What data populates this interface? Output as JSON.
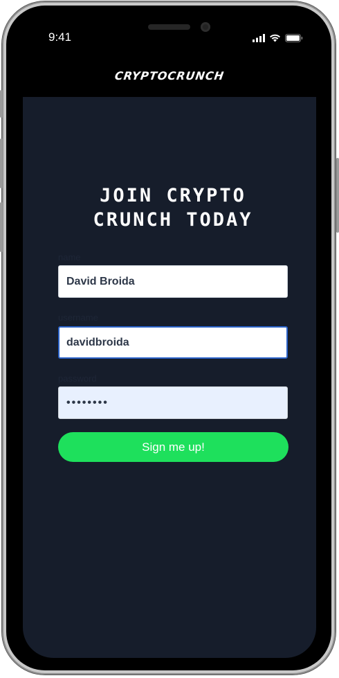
{
  "status_bar": {
    "time": "9:41",
    "icons": [
      "cellular-signal-icon",
      "wifi-icon",
      "battery-icon"
    ]
  },
  "header": {
    "brand": "CRYPTOCRUNCH"
  },
  "main": {
    "headline_line1": "JOIN CRYPTO",
    "headline_line2": "CRUNCH TODAY"
  },
  "form": {
    "name": {
      "label": "name",
      "value": "David Broida"
    },
    "username": {
      "label": "username",
      "value": "davidbroida"
    },
    "password": {
      "label": "password",
      "value": "••••••••"
    },
    "submit_label": "Sign me up!"
  },
  "colors": {
    "screen_background": "#161d2b",
    "accent_green": "#1ee05c",
    "focus_border": "#2a62c9",
    "autofill_background": "#e8f0fe"
  }
}
